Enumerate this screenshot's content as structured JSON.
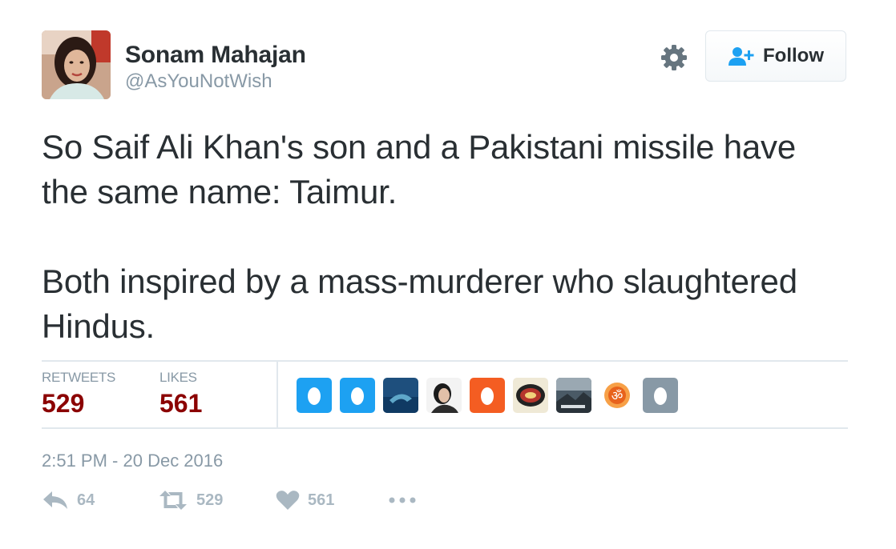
{
  "user": {
    "name": "Sonam Mahajan",
    "handle": "@AsYouNotWish"
  },
  "header": {
    "settings_icon": "gear-icon",
    "follow_label": "Follow",
    "follow_icon": "add-user-icon"
  },
  "tweet": {
    "paragraphs": [
      "So Saif Ali Khan's son and a Pakistani missile have the same name: Taimur.",
      "Both inspired by a mass-murderer who slaughtered Hindus."
    ]
  },
  "stats": {
    "retweets_label": "RETWEETS",
    "retweets_value": "529",
    "likes_label": "LIKES",
    "likes_value": "561"
  },
  "likers": [
    {
      "kind": "egg",
      "color": "#1da1f2"
    },
    {
      "kind": "egg",
      "color": "#1da1f2"
    },
    {
      "kind": "photo-ocean",
      "color": "#1e4f7d"
    },
    {
      "kind": "photo-woman",
      "color": "#f3f3f3"
    },
    {
      "kind": "egg",
      "color": "#f45d22"
    },
    {
      "kind": "badge-logo",
      "color": "#efe9d6"
    },
    {
      "kind": "photo-landscape",
      "color": "#4a5a66"
    },
    {
      "kind": "om-symbol",
      "color": "#e8621c"
    },
    {
      "kind": "egg",
      "color": "#8899a6"
    }
  ],
  "timestamp": "2:51 PM - 20 Dec 2016",
  "actions": {
    "reply_icon": "reply-icon",
    "reply_count": "64",
    "retweet_icon": "retweet-icon",
    "retweet_count": "529",
    "like_icon": "heart-icon",
    "like_count": "561",
    "more_icon": "more-dots-icon"
  },
  "colors": {
    "text": "#292f33",
    "muted": "#8899a6",
    "stat_value": "#8b0000",
    "border": "#e1e8ed",
    "accent": "#1da1f2",
    "action_gray": "#aab8c2"
  }
}
